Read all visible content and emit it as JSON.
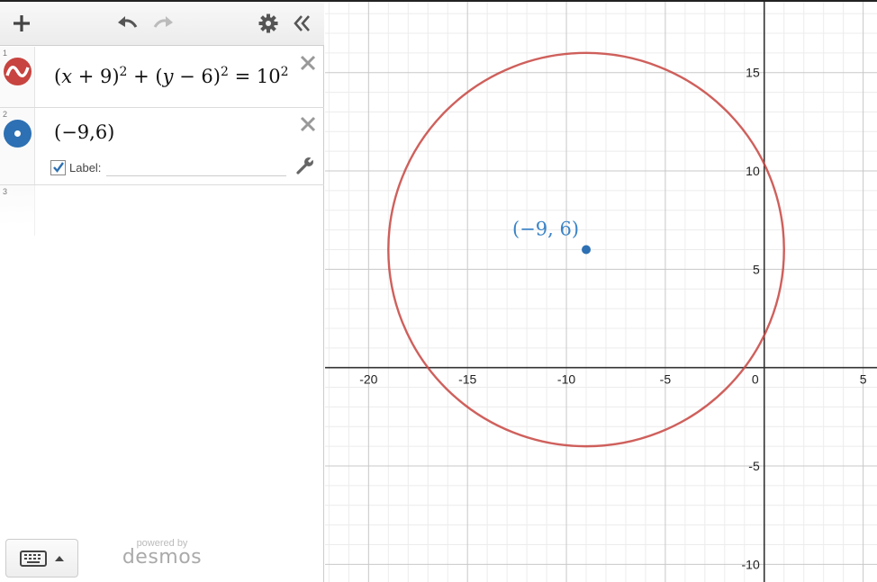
{
  "toolbar": {
    "add_icon": "plus-icon",
    "undo_icon": "undo-icon",
    "redo_icon": "redo-icon",
    "settings_icon": "gear-icon",
    "collapse_icon": "double-chevron-left-icon"
  },
  "expressions": [
    {
      "number": "1",
      "type": "equation",
      "color": "#c74440",
      "latex_text": "(x+9)^2+(y-6)^2=10^2",
      "parts": {
        "open1": "(",
        "x": "x",
        "plus9": " + 9)",
        "exp1": "2",
        "mid": " + (",
        "y": "y",
        "minus6": " − 6)",
        "exp2": "2",
        "eq": " = 10",
        "exp3": "2"
      }
    },
    {
      "number": "2",
      "type": "point",
      "color": "#2d70b3",
      "text": "(−9,6)",
      "label_checkbox": "Label:",
      "label_checked": true,
      "label_value": ""
    },
    {
      "number": "3",
      "type": "empty"
    }
  ],
  "footer": {
    "keyboard_icon": "keyboard-icon",
    "powered_by": "powered by",
    "brand": "desmos"
  },
  "graph": {
    "x_ticks": [
      "-20",
      "-15",
      "-10",
      "-5",
      "0",
      "5"
    ],
    "y_ticks": [
      "15",
      "10",
      "5",
      "-5",
      "-10"
    ],
    "circle": {
      "center": [
        -9,
        6
      ],
      "radius": 10,
      "color": "#c74440"
    },
    "point": {
      "x": -9,
      "y": 6,
      "color": "#2d70b3",
      "label": "(−9, 6)"
    },
    "xrange": [
      -22.2,
      5.7
    ],
    "yrange": [
      -10.9,
      18.6
    ]
  }
}
